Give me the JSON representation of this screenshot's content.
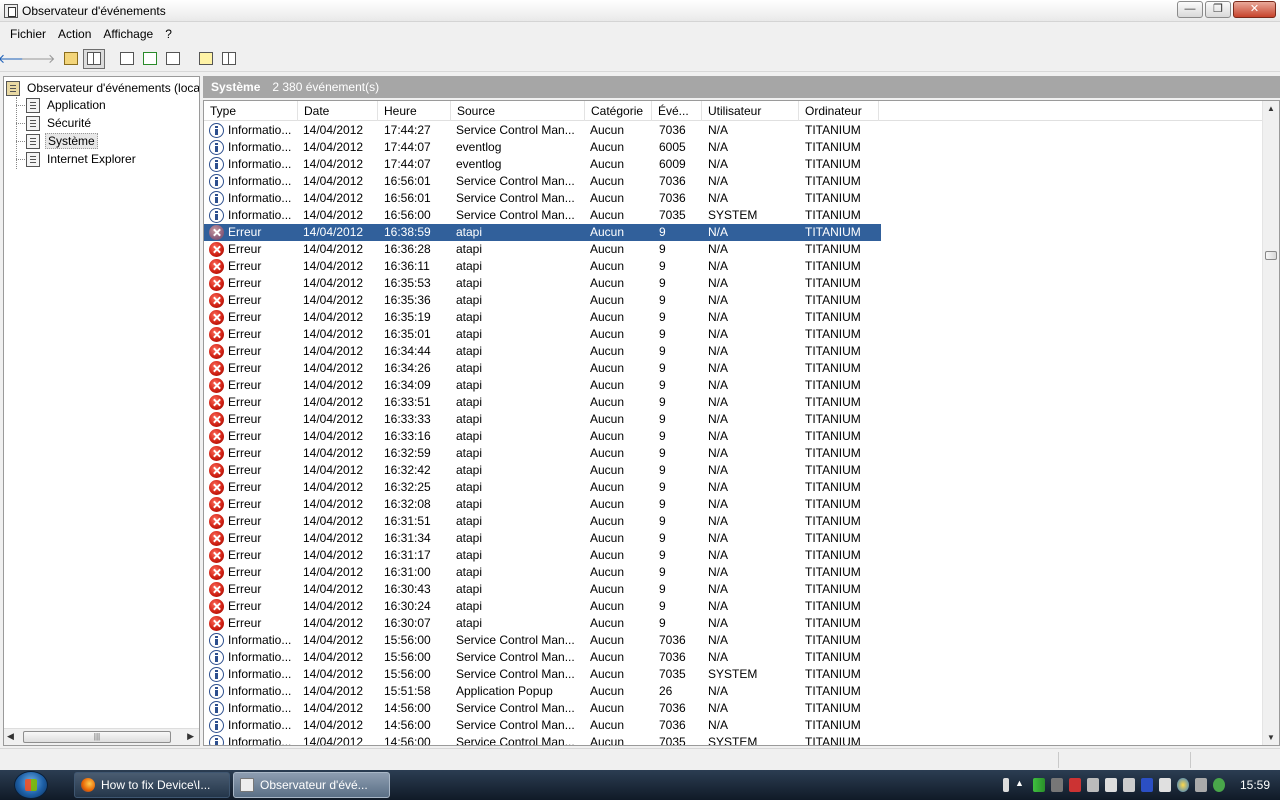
{
  "window": {
    "title": "Observateur d'événements"
  },
  "window_buttons": {
    "minimize": "—",
    "maximize": "❐",
    "close": "✕"
  },
  "menu": [
    "Fichier",
    "Action",
    "Affichage",
    "?"
  ],
  "toolbar": {
    "back_icon": "back-arrow-icon",
    "forward_icon": "forward-arrow-icon",
    "buttons": [
      "up-folder-icon",
      "show-hide-tree-icon",
      "properties-icon",
      "refresh-icon",
      "export-list-icon",
      "help-icon",
      "show-hide-action-pane-icon"
    ]
  },
  "tree": {
    "root": "Observateur d'événements (local)",
    "items": [
      "Application",
      "Sécurité",
      "Système",
      "Internet Explorer"
    ],
    "selected": "Système"
  },
  "pane": {
    "title": "Système",
    "count": "2 380 événement(s)"
  },
  "columns": [
    "Type",
    "Date",
    "Heure",
    "Source",
    "Catégorie",
    "Évé...",
    "Utilisateur",
    "Ordinateur"
  ],
  "rows": [
    {
      "type": "Informatio...",
      "icon": "info",
      "date": "14/04/2012",
      "time": "17:44:27",
      "source": "Service Control Man...",
      "category": "Aucun",
      "event": "7036",
      "user": "N/A",
      "computer": "TITANIUM"
    },
    {
      "type": "Informatio...",
      "icon": "info",
      "date": "14/04/2012",
      "time": "17:44:07",
      "source": "eventlog",
      "category": "Aucun",
      "event": "6005",
      "user": "N/A",
      "computer": "TITANIUM"
    },
    {
      "type": "Informatio...",
      "icon": "info",
      "date": "14/04/2012",
      "time": "17:44:07",
      "source": "eventlog",
      "category": "Aucun",
      "event": "6009",
      "user": "N/A",
      "computer": "TITANIUM"
    },
    {
      "type": "Informatio...",
      "icon": "info",
      "date": "14/04/2012",
      "time": "16:56:01",
      "source": "Service Control Man...",
      "category": "Aucun",
      "event": "7036",
      "user": "N/A",
      "computer": "TITANIUM"
    },
    {
      "type": "Informatio...",
      "icon": "info",
      "date": "14/04/2012",
      "time": "16:56:01",
      "source": "Service Control Man...",
      "category": "Aucun",
      "event": "7036",
      "user": "N/A",
      "computer": "TITANIUM"
    },
    {
      "type": "Informatio...",
      "icon": "info",
      "date": "14/04/2012",
      "time": "16:56:00",
      "source": "Service Control Man...",
      "category": "Aucun",
      "event": "7035",
      "user": "SYSTEM",
      "computer": "TITANIUM"
    },
    {
      "type": "Erreur",
      "icon": "error",
      "date": "14/04/2012",
      "time": "16:38:59",
      "source": "atapi",
      "category": "Aucun",
      "event": "9",
      "user": "N/A",
      "computer": "TITANIUM",
      "selected": true
    },
    {
      "type": "Erreur",
      "icon": "error",
      "date": "14/04/2012",
      "time": "16:36:28",
      "source": "atapi",
      "category": "Aucun",
      "event": "9",
      "user": "N/A",
      "computer": "TITANIUM"
    },
    {
      "type": "Erreur",
      "icon": "error",
      "date": "14/04/2012",
      "time": "16:36:11",
      "source": "atapi",
      "category": "Aucun",
      "event": "9",
      "user": "N/A",
      "computer": "TITANIUM"
    },
    {
      "type": "Erreur",
      "icon": "error",
      "date": "14/04/2012",
      "time": "16:35:53",
      "source": "atapi",
      "category": "Aucun",
      "event": "9",
      "user": "N/A",
      "computer": "TITANIUM"
    },
    {
      "type": "Erreur",
      "icon": "error",
      "date": "14/04/2012",
      "time": "16:35:36",
      "source": "atapi",
      "category": "Aucun",
      "event": "9",
      "user": "N/A",
      "computer": "TITANIUM"
    },
    {
      "type": "Erreur",
      "icon": "error",
      "date": "14/04/2012",
      "time": "16:35:19",
      "source": "atapi",
      "category": "Aucun",
      "event": "9",
      "user": "N/A",
      "computer": "TITANIUM"
    },
    {
      "type": "Erreur",
      "icon": "error",
      "date": "14/04/2012",
      "time": "16:35:01",
      "source": "atapi",
      "category": "Aucun",
      "event": "9",
      "user": "N/A",
      "computer": "TITANIUM"
    },
    {
      "type": "Erreur",
      "icon": "error",
      "date": "14/04/2012",
      "time": "16:34:44",
      "source": "atapi",
      "category": "Aucun",
      "event": "9",
      "user": "N/A",
      "computer": "TITANIUM"
    },
    {
      "type": "Erreur",
      "icon": "error",
      "date": "14/04/2012",
      "time": "16:34:26",
      "source": "atapi",
      "category": "Aucun",
      "event": "9",
      "user": "N/A",
      "computer": "TITANIUM"
    },
    {
      "type": "Erreur",
      "icon": "error",
      "date": "14/04/2012",
      "time": "16:34:09",
      "source": "atapi",
      "category": "Aucun",
      "event": "9",
      "user": "N/A",
      "computer": "TITANIUM"
    },
    {
      "type": "Erreur",
      "icon": "error",
      "date": "14/04/2012",
      "time": "16:33:51",
      "source": "atapi",
      "category": "Aucun",
      "event": "9",
      "user": "N/A",
      "computer": "TITANIUM"
    },
    {
      "type": "Erreur",
      "icon": "error",
      "date": "14/04/2012",
      "time": "16:33:33",
      "source": "atapi",
      "category": "Aucun",
      "event": "9",
      "user": "N/A",
      "computer": "TITANIUM"
    },
    {
      "type": "Erreur",
      "icon": "error",
      "date": "14/04/2012",
      "time": "16:33:16",
      "source": "atapi",
      "category": "Aucun",
      "event": "9",
      "user": "N/A",
      "computer": "TITANIUM"
    },
    {
      "type": "Erreur",
      "icon": "error",
      "date": "14/04/2012",
      "time": "16:32:59",
      "source": "atapi",
      "category": "Aucun",
      "event": "9",
      "user": "N/A",
      "computer": "TITANIUM"
    },
    {
      "type": "Erreur",
      "icon": "error",
      "date": "14/04/2012",
      "time": "16:32:42",
      "source": "atapi",
      "category": "Aucun",
      "event": "9",
      "user": "N/A",
      "computer": "TITANIUM"
    },
    {
      "type": "Erreur",
      "icon": "error",
      "date": "14/04/2012",
      "time": "16:32:25",
      "source": "atapi",
      "category": "Aucun",
      "event": "9",
      "user": "N/A",
      "computer": "TITANIUM"
    },
    {
      "type": "Erreur",
      "icon": "error",
      "date": "14/04/2012",
      "time": "16:32:08",
      "source": "atapi",
      "category": "Aucun",
      "event": "9",
      "user": "N/A",
      "computer": "TITANIUM"
    },
    {
      "type": "Erreur",
      "icon": "error",
      "date": "14/04/2012",
      "time": "16:31:51",
      "source": "atapi",
      "category": "Aucun",
      "event": "9",
      "user": "N/A",
      "computer": "TITANIUM"
    },
    {
      "type": "Erreur",
      "icon": "error",
      "date": "14/04/2012",
      "time": "16:31:34",
      "source": "atapi",
      "category": "Aucun",
      "event": "9",
      "user": "N/A",
      "computer": "TITANIUM"
    },
    {
      "type": "Erreur",
      "icon": "error",
      "date": "14/04/2012",
      "time": "16:31:17",
      "source": "atapi",
      "category": "Aucun",
      "event": "9",
      "user": "N/A",
      "computer": "TITANIUM"
    },
    {
      "type": "Erreur",
      "icon": "error",
      "date": "14/04/2012",
      "time": "16:31:00",
      "source": "atapi",
      "category": "Aucun",
      "event": "9",
      "user": "N/A",
      "computer": "TITANIUM"
    },
    {
      "type": "Erreur",
      "icon": "error",
      "date": "14/04/2012",
      "time": "16:30:43",
      "source": "atapi",
      "category": "Aucun",
      "event": "9",
      "user": "N/A",
      "computer": "TITANIUM"
    },
    {
      "type": "Erreur",
      "icon": "error",
      "date": "14/04/2012",
      "time": "16:30:24",
      "source": "atapi",
      "category": "Aucun",
      "event": "9",
      "user": "N/A",
      "computer": "TITANIUM"
    },
    {
      "type": "Erreur",
      "icon": "error",
      "date": "14/04/2012",
      "time": "16:30:07",
      "source": "atapi",
      "category": "Aucun",
      "event": "9",
      "user": "N/A",
      "computer": "TITANIUM"
    },
    {
      "type": "Informatio...",
      "icon": "info",
      "date": "14/04/2012",
      "time": "15:56:00",
      "source": "Service Control Man...",
      "category": "Aucun",
      "event": "7036",
      "user": "N/A",
      "computer": "TITANIUM"
    },
    {
      "type": "Informatio...",
      "icon": "info",
      "date": "14/04/2012",
      "time": "15:56:00",
      "source": "Service Control Man...",
      "category": "Aucun",
      "event": "7036",
      "user": "N/A",
      "computer": "TITANIUM"
    },
    {
      "type": "Informatio...",
      "icon": "info",
      "date": "14/04/2012",
      "time": "15:56:00",
      "source": "Service Control Man...",
      "category": "Aucun",
      "event": "7035",
      "user": "SYSTEM",
      "computer": "TITANIUM"
    },
    {
      "type": "Informatio...",
      "icon": "info",
      "date": "14/04/2012",
      "time": "15:51:58",
      "source": "Application Popup",
      "category": "Aucun",
      "event": "26",
      "user": "N/A",
      "computer": "TITANIUM"
    },
    {
      "type": "Informatio...",
      "icon": "info",
      "date": "14/04/2012",
      "time": "14:56:00",
      "source": "Service Control Man...",
      "category": "Aucun",
      "event": "7036",
      "user": "N/A",
      "computer": "TITANIUM"
    },
    {
      "type": "Informatio...",
      "icon": "info",
      "date": "14/04/2012",
      "time": "14:56:00",
      "source": "Service Control Man...",
      "category": "Aucun",
      "event": "7036",
      "user": "N/A",
      "computer": "TITANIUM"
    },
    {
      "type": "Informatio...",
      "icon": "info",
      "date": "14/04/2012",
      "time": "14:56:00",
      "source": "Service Control Man...",
      "category": "Aucun",
      "event": "7035",
      "user": "SYSTEM",
      "computer": "TITANIUM"
    }
  ],
  "taskbar": {
    "tasks": [
      {
        "label": "How to fix Device\\I...",
        "icon": "firefox-icon",
        "active": false
      },
      {
        "label": "Observateur d'évé...",
        "icon": "event-viewer-icon",
        "active": true
      }
    ],
    "clock": "15:59"
  }
}
